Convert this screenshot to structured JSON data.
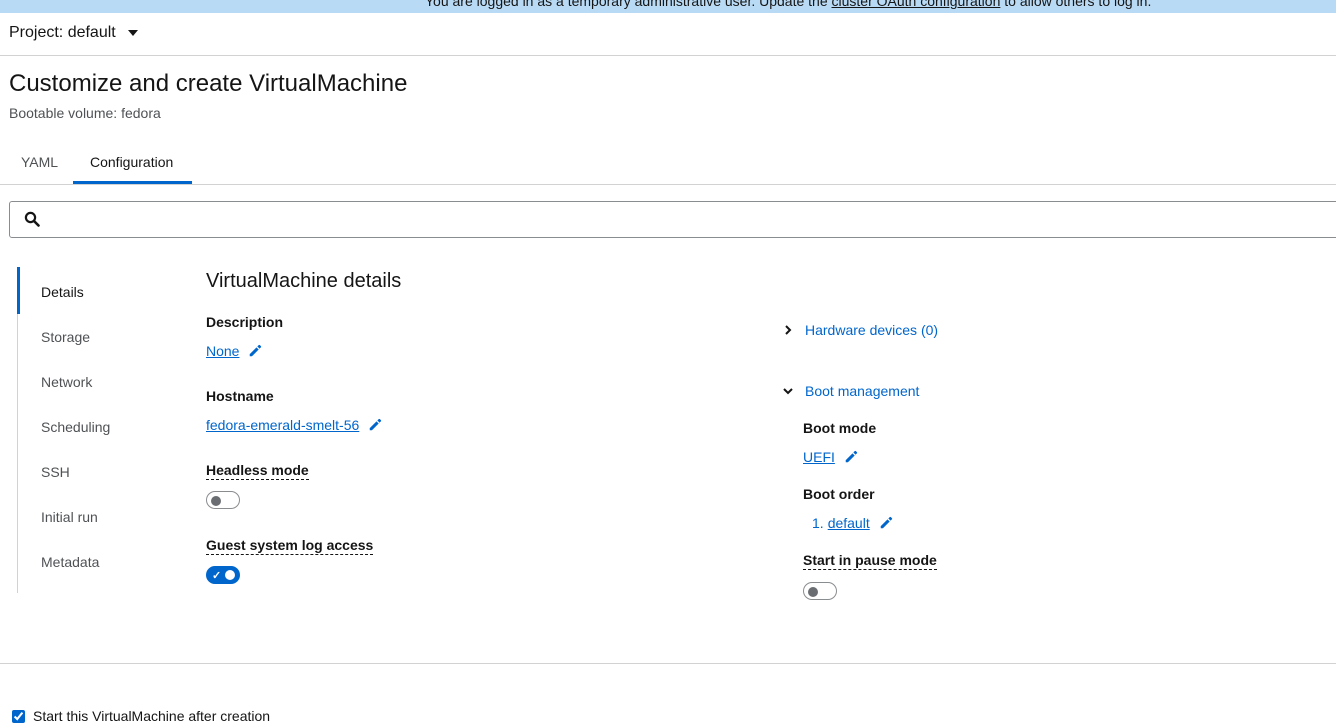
{
  "banner": {
    "text_before": "You are logged in as a temporary administrative user. Update the ",
    "link": "cluster OAuth configuration",
    "text_after": " to allow others to log in."
  },
  "project": {
    "label": "Project: default"
  },
  "page": {
    "title": "Customize and create VirtualMachine",
    "subtitle": "Bootable volume: fedora"
  },
  "tabs": [
    {
      "label": "YAML",
      "active": false
    },
    {
      "label": "Configuration",
      "active": true
    }
  ],
  "search": {
    "placeholder": "",
    "value": ""
  },
  "jump_nav": {
    "items": [
      "Details",
      "Storage",
      "Network",
      "Scheduling",
      "SSH",
      "Initial run",
      "Metadata"
    ],
    "active": "Details"
  },
  "details": {
    "section_title": "VirtualMachine details",
    "description": {
      "label": "Description",
      "value": "None"
    },
    "hostname": {
      "label": "Hostname",
      "value": "fedora-emerald-smelt-56"
    },
    "headless_mode": {
      "label": "Headless mode",
      "enabled": false
    },
    "guest_log": {
      "label": "Guest system log access",
      "enabled": true
    }
  },
  "right": {
    "hardware_devices": {
      "label": "Hardware devices (0)",
      "expanded": false
    },
    "boot_management": {
      "label": "Boot management",
      "expanded": true
    },
    "boot_mode": {
      "label": "Boot mode",
      "value": "UEFI"
    },
    "boot_order": {
      "label": "Boot order",
      "number": "1.",
      "value": "default"
    },
    "pause_mode": {
      "label": "Start in pause mode",
      "enabled": false
    }
  },
  "footer": {
    "start_after_creation": "Start this VirtualMachine after creation",
    "checked": true
  },
  "colors": {
    "accent": "#0066cc",
    "banner": "#b9daf5"
  }
}
